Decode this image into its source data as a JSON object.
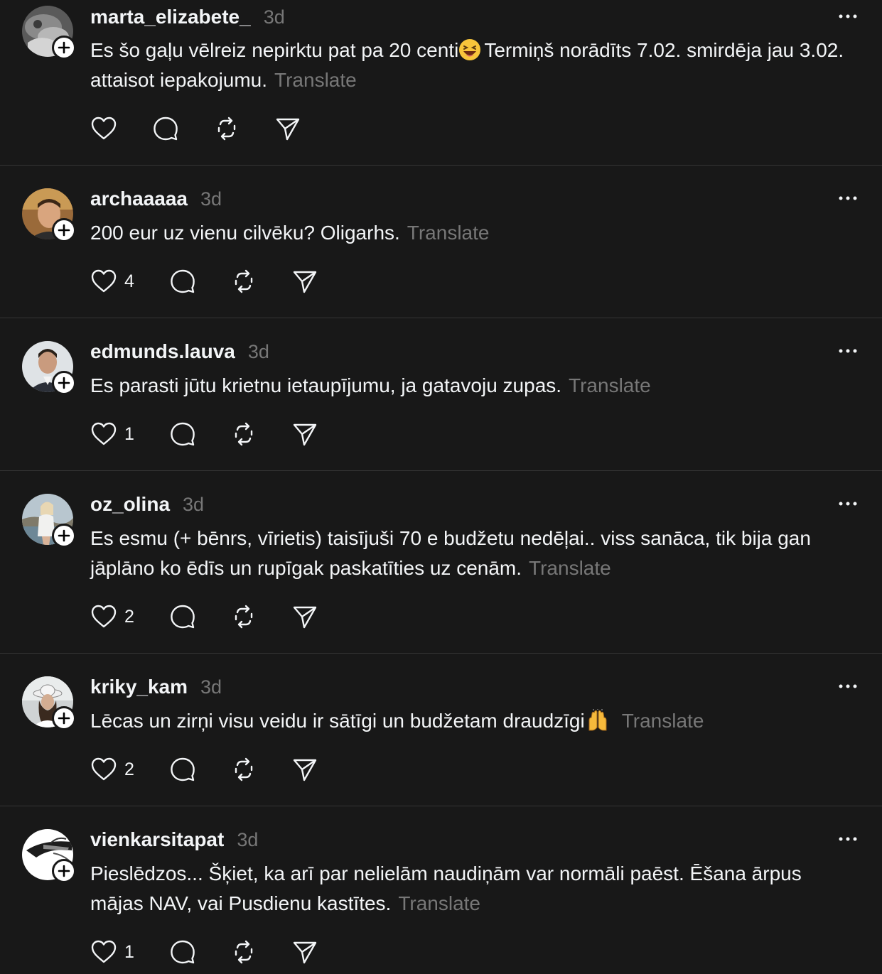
{
  "translate_label": "Translate",
  "colors": {
    "background": "#181818",
    "text": "#f3f5f7",
    "muted": "#777777",
    "divider": "#353535"
  },
  "posts": [
    {
      "username": "marta_elizabete_",
      "time": "3d",
      "text_before": "Es šo gaļu vēlreiz nepirktu pat pa 20 centi",
      "emoji": "laughing-face",
      "text_after": "Termiņš norādīts 7.02. smirdēja jau 3.02. attaisot iepakojumu.",
      "likes": "",
      "avatar": "marta"
    },
    {
      "username": "archaaaaa",
      "time": "3d",
      "text_before": "200 eur uz vienu cilvēku? Oligarhs.",
      "emoji": "",
      "text_after": "",
      "likes": "4",
      "avatar": "archa"
    },
    {
      "username": "edmunds.lauva",
      "time": "3d",
      "text_before": "Es parasti jūtu krietnu ietaupījumu, ja gatavoju zupas.",
      "emoji": "",
      "text_after": "",
      "likes": "1",
      "avatar": "edmunds"
    },
    {
      "username": "oz_olina",
      "time": "3d",
      "text_before": "Es esmu (+ bēnrs, vīrietis) taisījuši 70 e budžetu nedēļai.. viss sanāca, tik bija gan jāplāno ko ēdīs un rupīgak paskatīties uz cenām.",
      "emoji": "",
      "text_after": "",
      "likes": "2",
      "avatar": "ozolina"
    },
    {
      "username": "kriky_kam",
      "time": "3d",
      "text_before": "Lēcas un zirņi visu veidu ir sātīgi un budžetam draudzīgi",
      "emoji": "raising-hands",
      "text_after": "",
      "likes": "2",
      "avatar": "kriky"
    },
    {
      "username": "vienkarsitapat",
      "time": "3d",
      "text_before": "Pieslēdzos... Šķiet, ka arī par nelielām naudiņām var normāli paēst. Ēšana ārpus mājas NAV, vai Pusdienu kastītes.",
      "emoji": "",
      "text_after": "",
      "likes": "1",
      "avatar": "vienk"
    }
  ]
}
